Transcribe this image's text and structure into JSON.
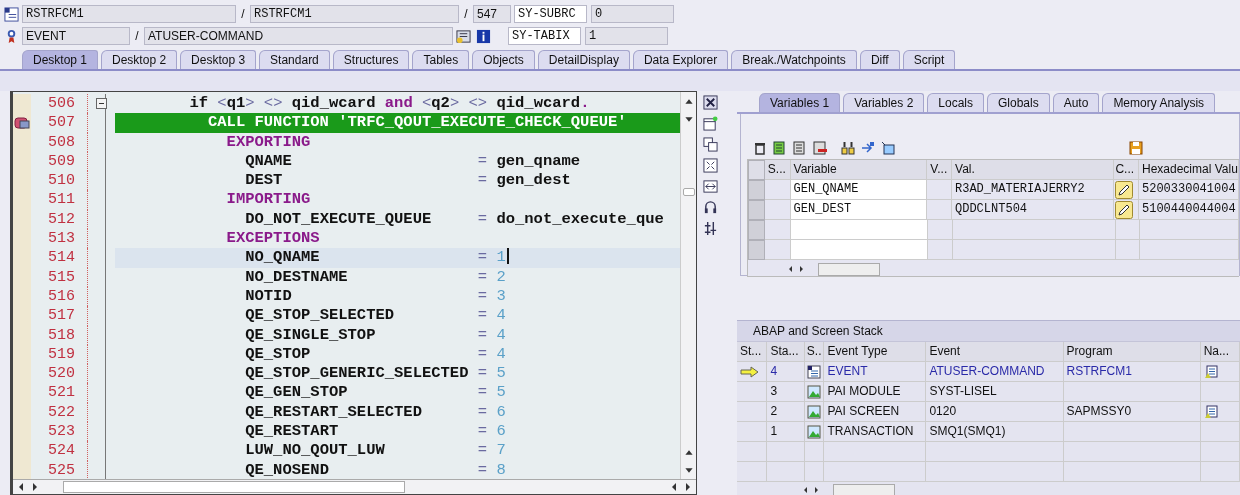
{
  "header": {
    "program": "RSTRFCM1",
    "separators": [
      "/",
      "/",
      "/"
    ],
    "include": "RSTRFCM1",
    "line": "547",
    "event_type": "EVENT",
    "event": "ATUSER-COMMAND",
    "watch": [
      {
        "name": "SY-SUBRC",
        "value": "0"
      },
      {
        "name": "SY-TABIX",
        "value": "1"
      }
    ]
  },
  "tabs": [
    {
      "label": "Desktop 1",
      "selected": true
    },
    {
      "label": "Desktop 2",
      "selected": false
    },
    {
      "label": "Desktop 3",
      "selected": false
    },
    {
      "label": "Standard",
      "selected": false
    },
    {
      "label": "Structures",
      "selected": false
    },
    {
      "label": "Tables",
      "selected": false
    },
    {
      "label": "Objects",
      "selected": false
    },
    {
      "label": "DetailDisplay",
      "selected": false
    },
    {
      "label": "Data Explorer",
      "selected": false
    },
    {
      "label": "Break./Watchpoints",
      "selected": false
    },
    {
      "label": "Diff",
      "selected": false
    },
    {
      "label": "Script",
      "selected": false
    }
  ],
  "code": [
    {
      "number": "506",
      "kind": "condition",
      "fold": true,
      "marker": false,
      "current": false,
      "cursor": false,
      "segments": [
        {
          "kind": "text",
          "text": "if "
        },
        {
          "kind": "op",
          "text": "<"
        },
        {
          "kind": "text",
          "text": "q1"
        },
        {
          "kind": "op",
          "text": "> <>"
        },
        {
          "kind": "text",
          "text": " qid_wcard "
        },
        {
          "kind": "keyword",
          "text": "and"
        },
        {
          "kind": "op",
          "text": " <"
        },
        {
          "kind": "text",
          "text": "q2"
        },
        {
          "kind": "op",
          "text": "> <>"
        },
        {
          "kind": "text",
          "text": " qid_wcard"
        },
        {
          "kind": "keyword",
          "text": "."
        }
      ]
    },
    {
      "number": "507",
      "kind": "call",
      "fold": false,
      "marker": true,
      "current": true,
      "cursor": false,
      "keyword": "CALL FUNCTION",
      "name": "'TRFC_QOUT_EXECUTE_CHECK_QUEUE'"
    },
    {
      "number": "508",
      "kind": "section",
      "fold": false,
      "marker": false,
      "current": false,
      "cursor": false,
      "keyword": "EXPORTING"
    },
    {
      "number": "509",
      "kind": "param",
      "fold": false,
      "marker": false,
      "current": false,
      "cursor": false,
      "name": "QNAME",
      "op": "=",
      "value": "gen_qname",
      "literal": false
    },
    {
      "number": "510",
      "kind": "param",
      "fold": false,
      "marker": false,
      "current": false,
      "cursor": false,
      "name": "DEST",
      "op": "=",
      "value": "gen_dest",
      "literal": false
    },
    {
      "number": "511",
      "kind": "section",
      "fold": false,
      "marker": false,
      "current": false,
      "cursor": false,
      "keyword": "IMPORTING"
    },
    {
      "number": "512",
      "kind": "param",
      "fold": false,
      "marker": false,
      "current": false,
      "cursor": false,
      "name": "DO_NOT_EXECUTE_QUEUE",
      "op": "=",
      "value": "do_not_execute_que",
      "literal": false
    },
    {
      "number": "513",
      "kind": "section",
      "fold": false,
      "marker": false,
      "current": false,
      "cursor": false,
      "keyword": "EXCEPTIONS"
    },
    {
      "number": "514",
      "kind": "param",
      "fold": false,
      "marker": false,
      "current": false,
      "cursor": true,
      "name": "NO_QNAME",
      "op": "=",
      "value": "1",
      "literal": true
    },
    {
      "number": "515",
      "kind": "param",
      "fold": false,
      "marker": false,
      "current": false,
      "cursor": false,
      "name": "NO_DESTNAME",
      "op": "=",
      "value": "2",
      "literal": true
    },
    {
      "number": "516",
      "kind": "param",
      "fold": false,
      "marker": false,
      "current": false,
      "cursor": false,
      "name": "NOTID",
      "op": "=",
      "value": "3",
      "literal": true
    },
    {
      "number": "517",
      "kind": "param",
      "fold": false,
      "marker": false,
      "current": false,
      "cursor": false,
      "name": "QE_STOP_SELECTED",
      "op": "=",
      "value": "4",
      "literal": true
    },
    {
      "number": "518",
      "kind": "param",
      "fold": false,
      "marker": false,
      "current": false,
      "cursor": false,
      "name": "QE_SINGLE_STOP",
      "op": "=",
      "value": "4",
      "literal": true
    },
    {
      "number": "519",
      "kind": "param",
      "fold": false,
      "marker": false,
      "current": false,
      "cursor": false,
      "name": "QE_STOP",
      "op": "=",
      "value": "4",
      "literal": true
    },
    {
      "number": "520",
      "kind": "param",
      "fold": false,
      "marker": false,
      "current": false,
      "cursor": false,
      "name": "QE_STOP_GENERIC_SELECTED",
      "op": "=",
      "value": "5",
      "literal": true
    },
    {
      "number": "521",
      "kind": "param",
      "fold": false,
      "marker": false,
      "current": false,
      "cursor": false,
      "name": "QE_GEN_STOP",
      "op": "=",
      "value": "5",
      "literal": true
    },
    {
      "number": "522",
      "kind": "param",
      "fold": false,
      "marker": false,
      "current": false,
      "cursor": false,
      "name": "QE_RESTART_SELECTED",
      "op": "=",
      "value": "6",
      "literal": true
    },
    {
      "number": "523",
      "kind": "param",
      "fold": false,
      "marker": false,
      "current": false,
      "cursor": false,
      "name": "QE_RESTART",
      "op": "=",
      "value": "6",
      "literal": true
    },
    {
      "number": "524",
      "kind": "param",
      "fold": false,
      "marker": false,
      "current": false,
      "cursor": false,
      "name": "LUW_NO_QOUT_LUW",
      "op": "=",
      "value": "7",
      "literal": true
    },
    {
      "number": "525",
      "kind": "param",
      "fold": false,
      "marker": false,
      "current": false,
      "cursor": false,
      "name": "QE_NOSEND",
      "op": "=",
      "value": "8",
      "literal": true
    }
  ],
  "var_tabs": [
    {
      "label": "Variables 1",
      "selected": true
    },
    {
      "label": "Variables 2",
      "selected": false
    },
    {
      "label": "Locals",
      "selected": false
    },
    {
      "label": "Globals",
      "selected": false
    },
    {
      "label": "Auto",
      "selected": false
    },
    {
      "label": "Memory Analysis",
      "selected": false
    }
  ],
  "variables": {
    "columns": [
      "S...",
      "Variable",
      "V...",
      "Val.",
      "C...",
      "Hexadecimal Valu"
    ],
    "rows": [
      {
        "variable": "GEN_QNAME",
        "value": "R3AD_MATERIAJERRY2",
        "editable": true,
        "hex": "5200330041004"
      },
      {
        "variable": "GEN_DEST",
        "value": "QDDCLNT504",
        "editable": true,
        "hex": "5100440044004"
      }
    ]
  },
  "stack": {
    "title": "ABAP and Screen Stack",
    "columns": [
      "St...",
      "Sta...",
      "S..",
      "Event Type",
      "Event",
      "Program",
      "Na..."
    ],
    "rows": [
      {
        "current": true,
        "level": "4",
        "kind": "event",
        "event_type": "EVENT",
        "event": "ATUSER-COMMAND",
        "program": "RSTRFCM1",
        "source": true
      },
      {
        "current": false,
        "level": "3",
        "kind": "screen",
        "event_type": "PAI MODULE",
        "event": "SYST-LISEL",
        "source": false
      },
      {
        "current": false,
        "level": "2",
        "kind": "screen",
        "event_type": "PAI SCREEN",
        "event": "0120",
        "program": "SAPMSSY0",
        "source": true
      },
      {
        "current": false,
        "level": "1",
        "kind": "screen",
        "event_type": "TRANSACTION",
        "event": "SMQ1(SMQ1)",
        "source": false
      }
    ]
  }
}
